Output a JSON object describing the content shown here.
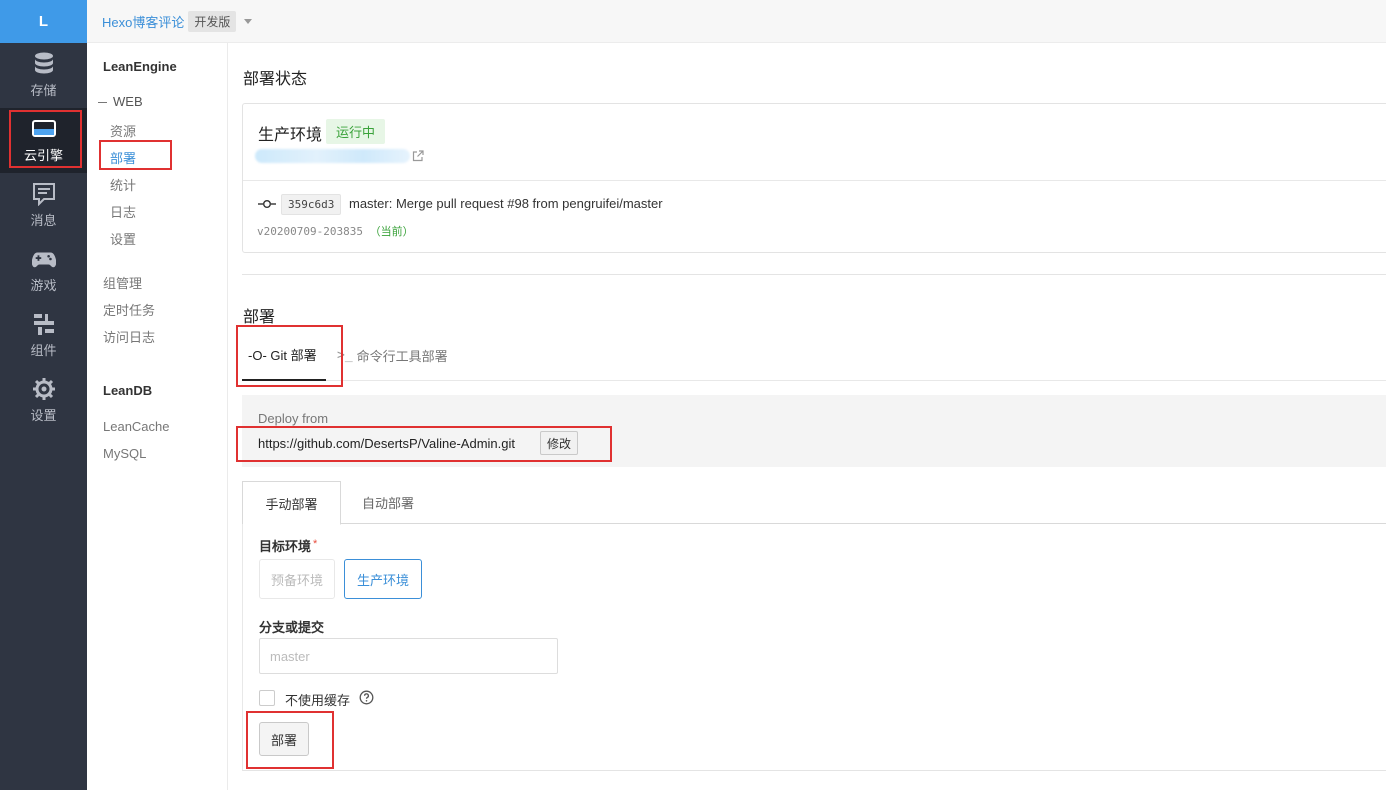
{
  "rail": {
    "logo": "L",
    "items": [
      {
        "label": "存储",
        "icon": "database-icon"
      },
      {
        "label": "云引擎",
        "icon": "server-icon"
      },
      {
        "label": "消息",
        "icon": "message-icon"
      },
      {
        "label": "游戏",
        "icon": "gamepad-icon"
      },
      {
        "label": "组件",
        "icon": "components-icon"
      },
      {
        "label": "设置",
        "icon": "gear-icon"
      }
    ]
  },
  "topbar": {
    "app_name": "Hexo博客评论",
    "env_badge": "开发版"
  },
  "subnav": {
    "leanengine_title": "LeanEngine",
    "web_group": "WEB",
    "web_items": [
      "资源",
      "部署",
      "统计",
      "日志",
      "设置"
    ],
    "other_items": [
      "组管理",
      "定时任务",
      "访问日志"
    ],
    "leandb_title": "LeanDB",
    "leandb_items": [
      "LeanCache",
      "MySQL"
    ]
  },
  "status": {
    "title": "部署状态",
    "env_name": "生产环境",
    "run_badge": "运行中",
    "commit_hash": "359c6d3",
    "commit_message": "master: Merge pull request #98 from pengruifei/master",
    "version": "v20200709-203835",
    "version_current": "（当前）"
  },
  "deploy": {
    "title": "部署",
    "tab_git": "-O- Git 部署",
    "tab_cli": "命令行工具部署",
    "deploy_from_label": "Deploy from",
    "repo_url": "https://github.com/DesertsP/Valine-Admin.git",
    "edit_button": "修改",
    "manual_tab": "手动部署",
    "auto_tab": "自动部署",
    "target_env_label": "目标环境",
    "env_staging": "预备环境",
    "env_production": "生产环境",
    "branch_label": "分支或提交",
    "branch_placeholder": "master",
    "no_cache_label": "不使用缓存",
    "deploy_button": "部署"
  }
}
